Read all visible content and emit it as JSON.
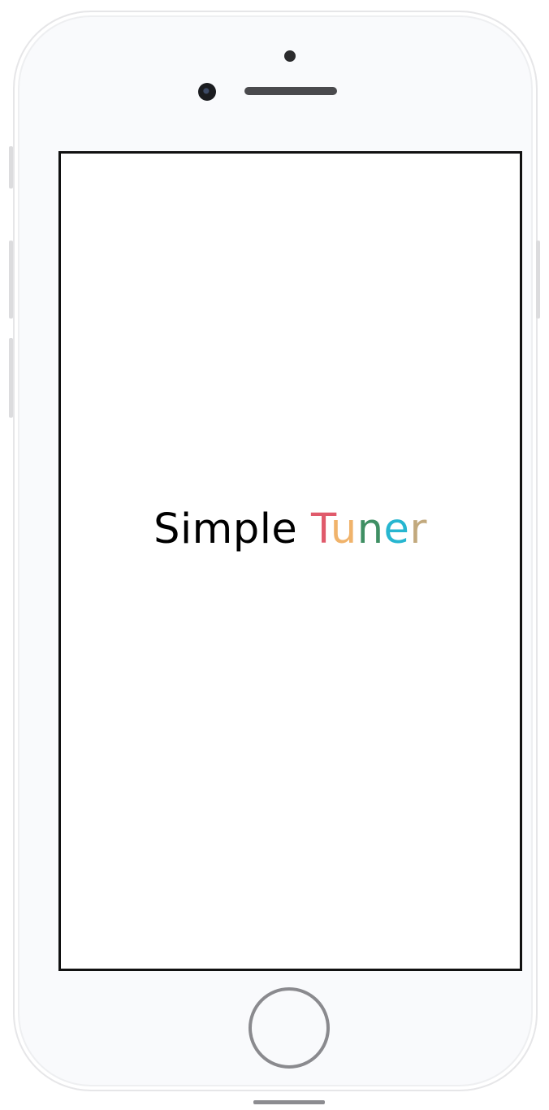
{
  "app": {
    "title_part1": "Simple",
    "title_part2_letters": [
      {
        "char": "T",
        "color": "#e05a6b"
      },
      {
        "char": "u",
        "color": "#f0b36b"
      },
      {
        "char": "n",
        "color": "#3f8f63"
      },
      {
        "char": "e",
        "color": "#27b6d0"
      },
      {
        "char": "r",
        "color": "#c2a97d"
      }
    ]
  },
  "colors": {
    "phone_body": "#f9fafc",
    "screen_bg": "#ffffff",
    "screen_border": "#111111",
    "title_text": "#000000"
  }
}
